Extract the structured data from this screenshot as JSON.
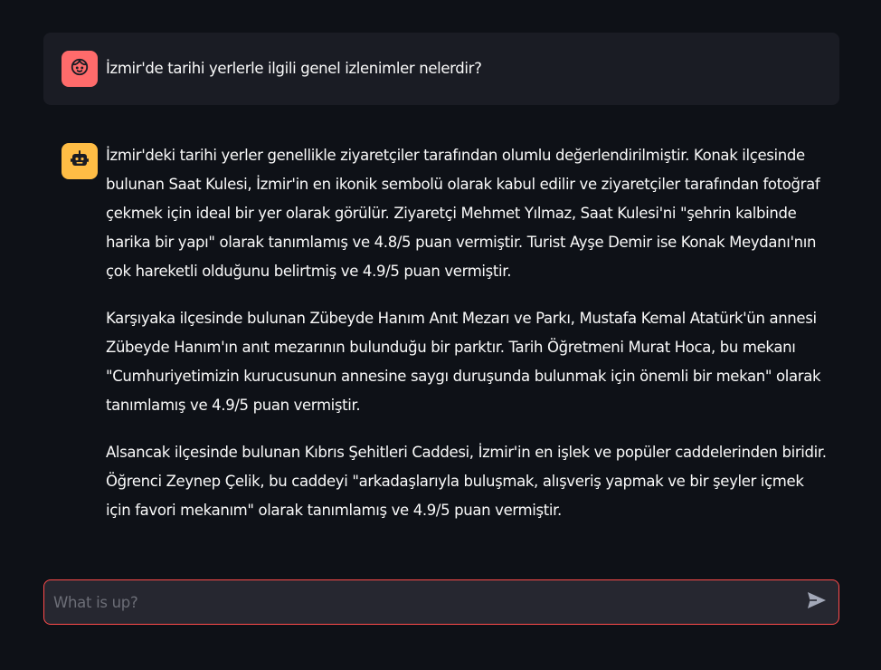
{
  "conversation": {
    "user_message": {
      "avatar_icon": "user-face-icon",
      "text": "İzmir'de tarihi yerlerle ilgili genel izlenimler nelerdir?"
    },
    "assistant_message": {
      "avatar_icon": "robot-icon",
      "paragraphs": [
        "İzmir'deki tarihi yerler genellikle ziyaretçiler tarafından olumlu değerlendirilmiştir. Konak ilçesinde bulunan Saat Kulesi, İzmir'in en ikonik sembolü olarak kabul edilir ve ziyaretçiler tarafından fotoğraf çekmek için ideal bir yer olarak görülür. Ziyaretçi Mehmet Yılmaz, Saat Kulesi'ni \"şehrin kalbinde harika bir yapı\" olarak tanımlamış ve 4.8/5 puan vermiştir. Turist Ayşe Demir ise Konak Meydanı'nın çok hareketli olduğunu belirtmiş ve 4.9/5 puan vermiştir.",
        "Karşıyaka ilçesinde bulunan Zübeyde Hanım Anıt Mezarı ve Parkı, Mustafa Kemal Atatürk'ün annesi Zübeyde Hanım'ın anıt mezarının bulunduğu bir parktır. Tarih Öğretmeni Murat Hoca, bu mekanı \"Cumhuriyetimizin kurucusunun annesine saygı duruşunda bulunmak için önemli bir mekan\" olarak tanımlamış ve 4.9/5 puan vermiştir.",
        "Alsancak ilçesinde bulunan Kıbrıs Şehitleri Caddesi, İzmir'in en işlek ve popüler caddelerinden biridir. Öğrenci Zeynep Çelik, bu caddeyi \"arkadaşlarıyla buluşmak, alışveriş yapmak ve bir şeyler içmek için favori mekanım\" olarak tanımlamış ve 4.9/5 puan vermiştir."
      ]
    }
  },
  "chat_input": {
    "placeholder": "What is up?",
    "value": "",
    "send_icon": "send-icon"
  },
  "colors": {
    "background": "#0e1117",
    "user_bubble": "#1a1c24",
    "user_avatar": "#ff6b6b",
    "assistant_avatar": "#ffbd45",
    "input_border": "#ff4b4b",
    "input_background": "#262730"
  }
}
